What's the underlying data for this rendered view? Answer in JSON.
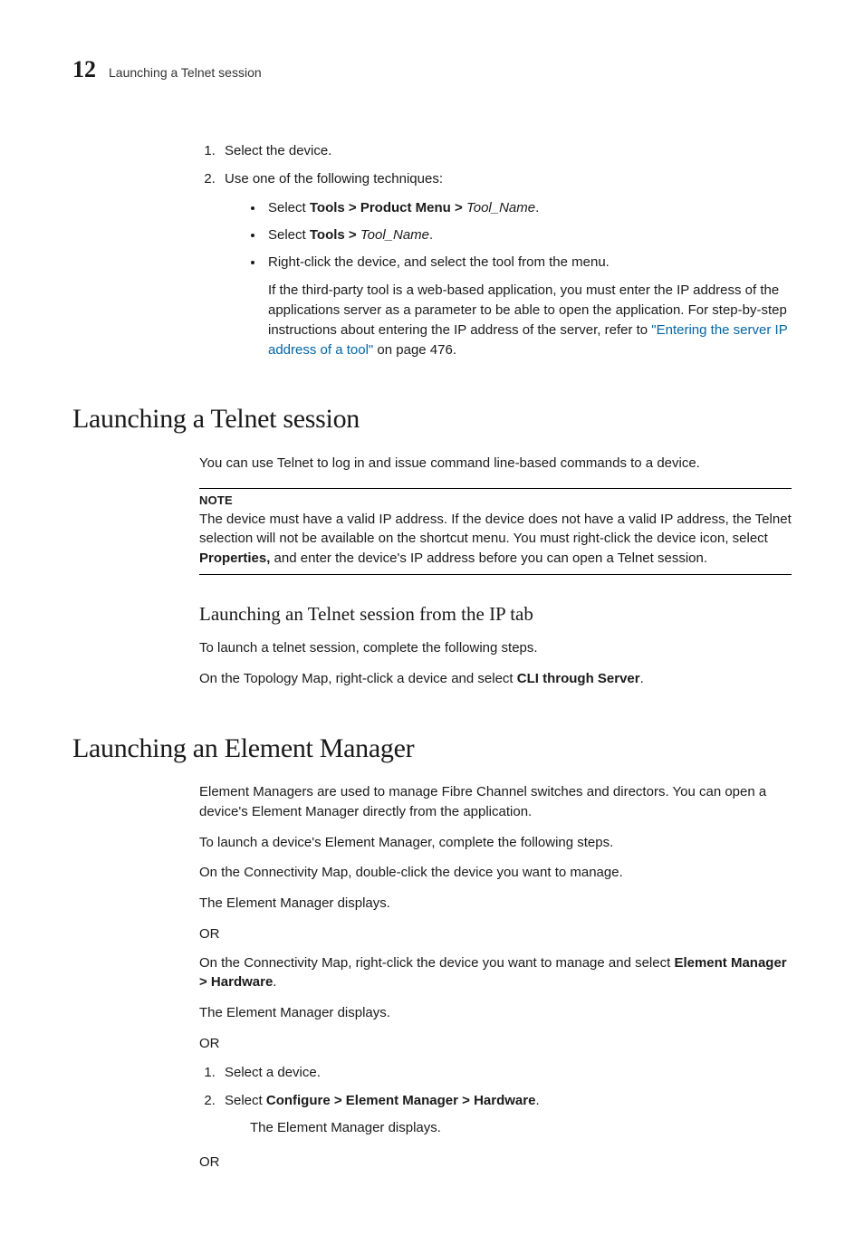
{
  "header": {
    "chapter_number": "12",
    "running_title": "Launching a Telnet session"
  },
  "intro_list": {
    "item1": "Select the device.",
    "item2": "Use one of the following techniques:",
    "bullet1_pre": "Select ",
    "bullet1_bold": "Tools > Product Menu > ",
    "bullet1_italic": "Tool_Name",
    "bullet1_post": ".",
    "bullet2_pre": "Select ",
    "bullet2_bold": "Tools > ",
    "bullet2_italic": "Tool_Name",
    "bullet2_post": ".",
    "bullet3": "Right-click the device, and select the tool from the menu.",
    "subnote_pre": "If the third-party tool is a web-based application, you must enter the IP address of the applications server as a parameter to be able to open the application. For step-by-step instructions about entering the IP address of the server, refer to ",
    "subnote_link": "\"Entering the server IP address of a tool\"",
    "subnote_post": " on page 476."
  },
  "telnet": {
    "heading": "Launching a Telnet session",
    "intro": "You can use Telnet to log in and issue command line-based commands to a device.",
    "note_label": "NOTE",
    "note_pre": "The device must have a valid IP address. If the device does not have a valid IP address, the Telnet selection will not be available on the shortcut menu. You must right-click the device icon, select ",
    "note_bold": "Properties,",
    "note_post": " and enter the device's IP address before you can open a Telnet session.",
    "sub_heading": "Launching an Telnet session from the IP tab",
    "step_intro": "To launch a telnet session, complete the following steps.",
    "step_line_pre": "On the Topology Map, right-click a device and select ",
    "step_line_bold": "CLI through Server",
    "step_line_post": "."
  },
  "element_manager": {
    "heading": "Launching an Element Manager",
    "intro": "Element Managers are used to manage Fibre Channel switches and directors. You can open a device's Element Manager directly from the application.",
    "step_intro": "To launch a device's Element Manager, complete the following steps.",
    "step1": "On the Connectivity Map, double-click the device you want to manage.",
    "result": "The Element Manager displays.",
    "or": "OR",
    "step2_pre": "On the Connectivity Map, right-click the device you want to manage and select ",
    "step2_bold": "Element Manager > Hardware",
    "step2_post": ".",
    "list_item1": "Select a device.",
    "list_item2_pre": "Select ",
    "list_item2_bold": "Configure > Element Manager > Hardware",
    "list_item2_post": "."
  }
}
